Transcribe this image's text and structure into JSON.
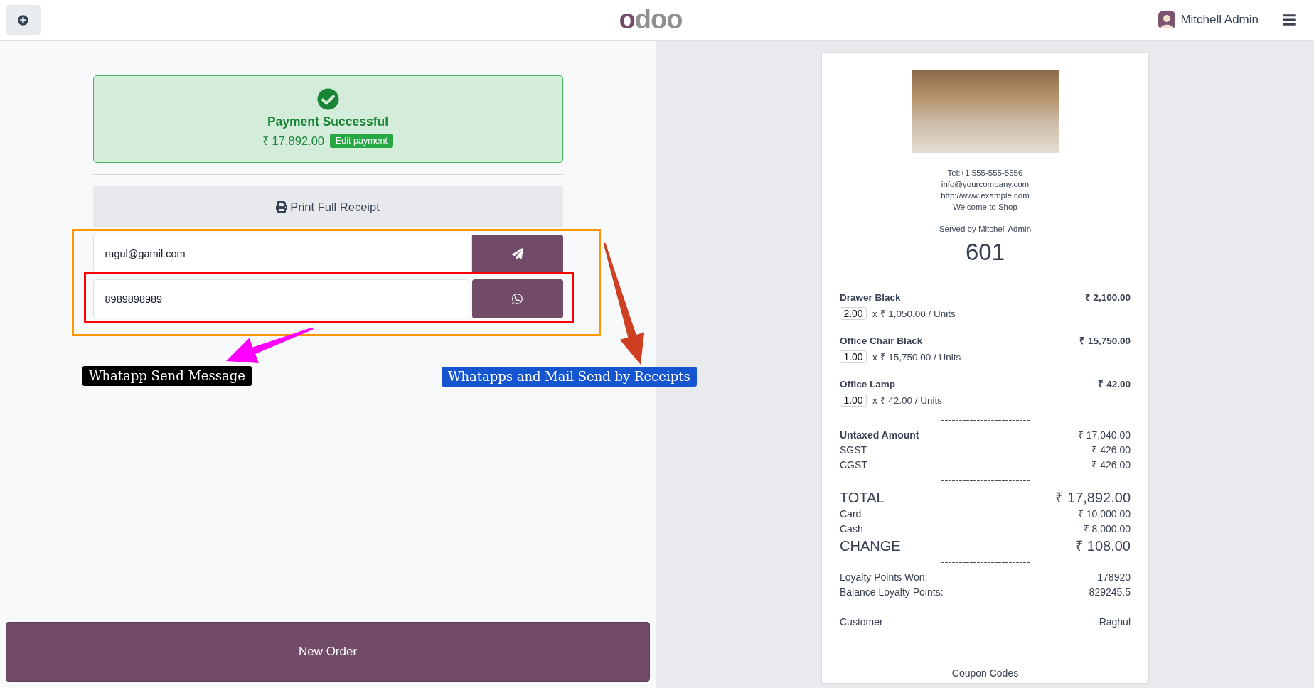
{
  "header": {
    "logo": "odoo",
    "user_name": "Mitchell Admin"
  },
  "payment": {
    "title": "Payment Successful",
    "amount": "₹ 17,892.00",
    "edit_button": "Edit payment"
  },
  "print_button": "Print Full Receipt",
  "email_field": {
    "value": "ragul@gamil.com"
  },
  "whatsapp_field": {
    "value": "8989898989"
  },
  "annotations": [
    {
      "text": "Whatapp Send Message"
    },
    {
      "text": "Whatapps and Mail Send by Receipts"
    }
  ],
  "new_order_button": "New Order",
  "receipt": {
    "contact_lines": [
      "Tel:+1 555-555-5556",
      "info@yourcompany.com",
      "http://www.example.com",
      "Welcome to Shop"
    ],
    "served_by": "Served by Mitchell Admin",
    "order_number": "601",
    "lines": [
      {
        "product": "Drawer Black",
        "quantity": "2.00",
        "unit_price": "x ₹ 1,050.00 / Units",
        "total": "₹ 2,100.00"
      },
      {
        "product": "Office Chair Black",
        "quantity": "1.00",
        "unit_price": "x ₹ 15,750.00 / Units",
        "total": "₹ 15,750.00"
      },
      {
        "product": "Office Lamp",
        "quantity": "1.00",
        "unit_price": "x ₹ 42.00 / Units",
        "total": "₹ 42.00"
      }
    ],
    "summary": [
      {
        "kind": "subtotal",
        "label": "Untaxed Amount",
        "value": "₹ 17,040.00"
      },
      {
        "kind": "tax",
        "label": "SGST",
        "value": "₹ 426.00"
      },
      {
        "kind": "tax",
        "label": "CGST",
        "value": "₹ 426.00"
      }
    ],
    "payments": [
      {
        "kind": "total",
        "label": "TOTAL",
        "value": "₹ 17,892.00"
      },
      {
        "kind": "payment",
        "label": "Card",
        "value": "₹ 10,000.00"
      },
      {
        "kind": "payment",
        "label": "Cash",
        "value": "₹ 8,000.00"
      },
      {
        "kind": "total",
        "label": "CHANGE",
        "value": "₹ 108.00"
      }
    ],
    "loyalty": [
      {
        "label": "Loyalty Points Won:",
        "value": "178920"
      },
      {
        "label": "Balance Loyalty Points:",
        "value": "829245.5"
      }
    ],
    "customer": {
      "label": "Customer",
      "value": "Raghul"
    },
    "coupon_heading": "Coupon Codes"
  }
}
